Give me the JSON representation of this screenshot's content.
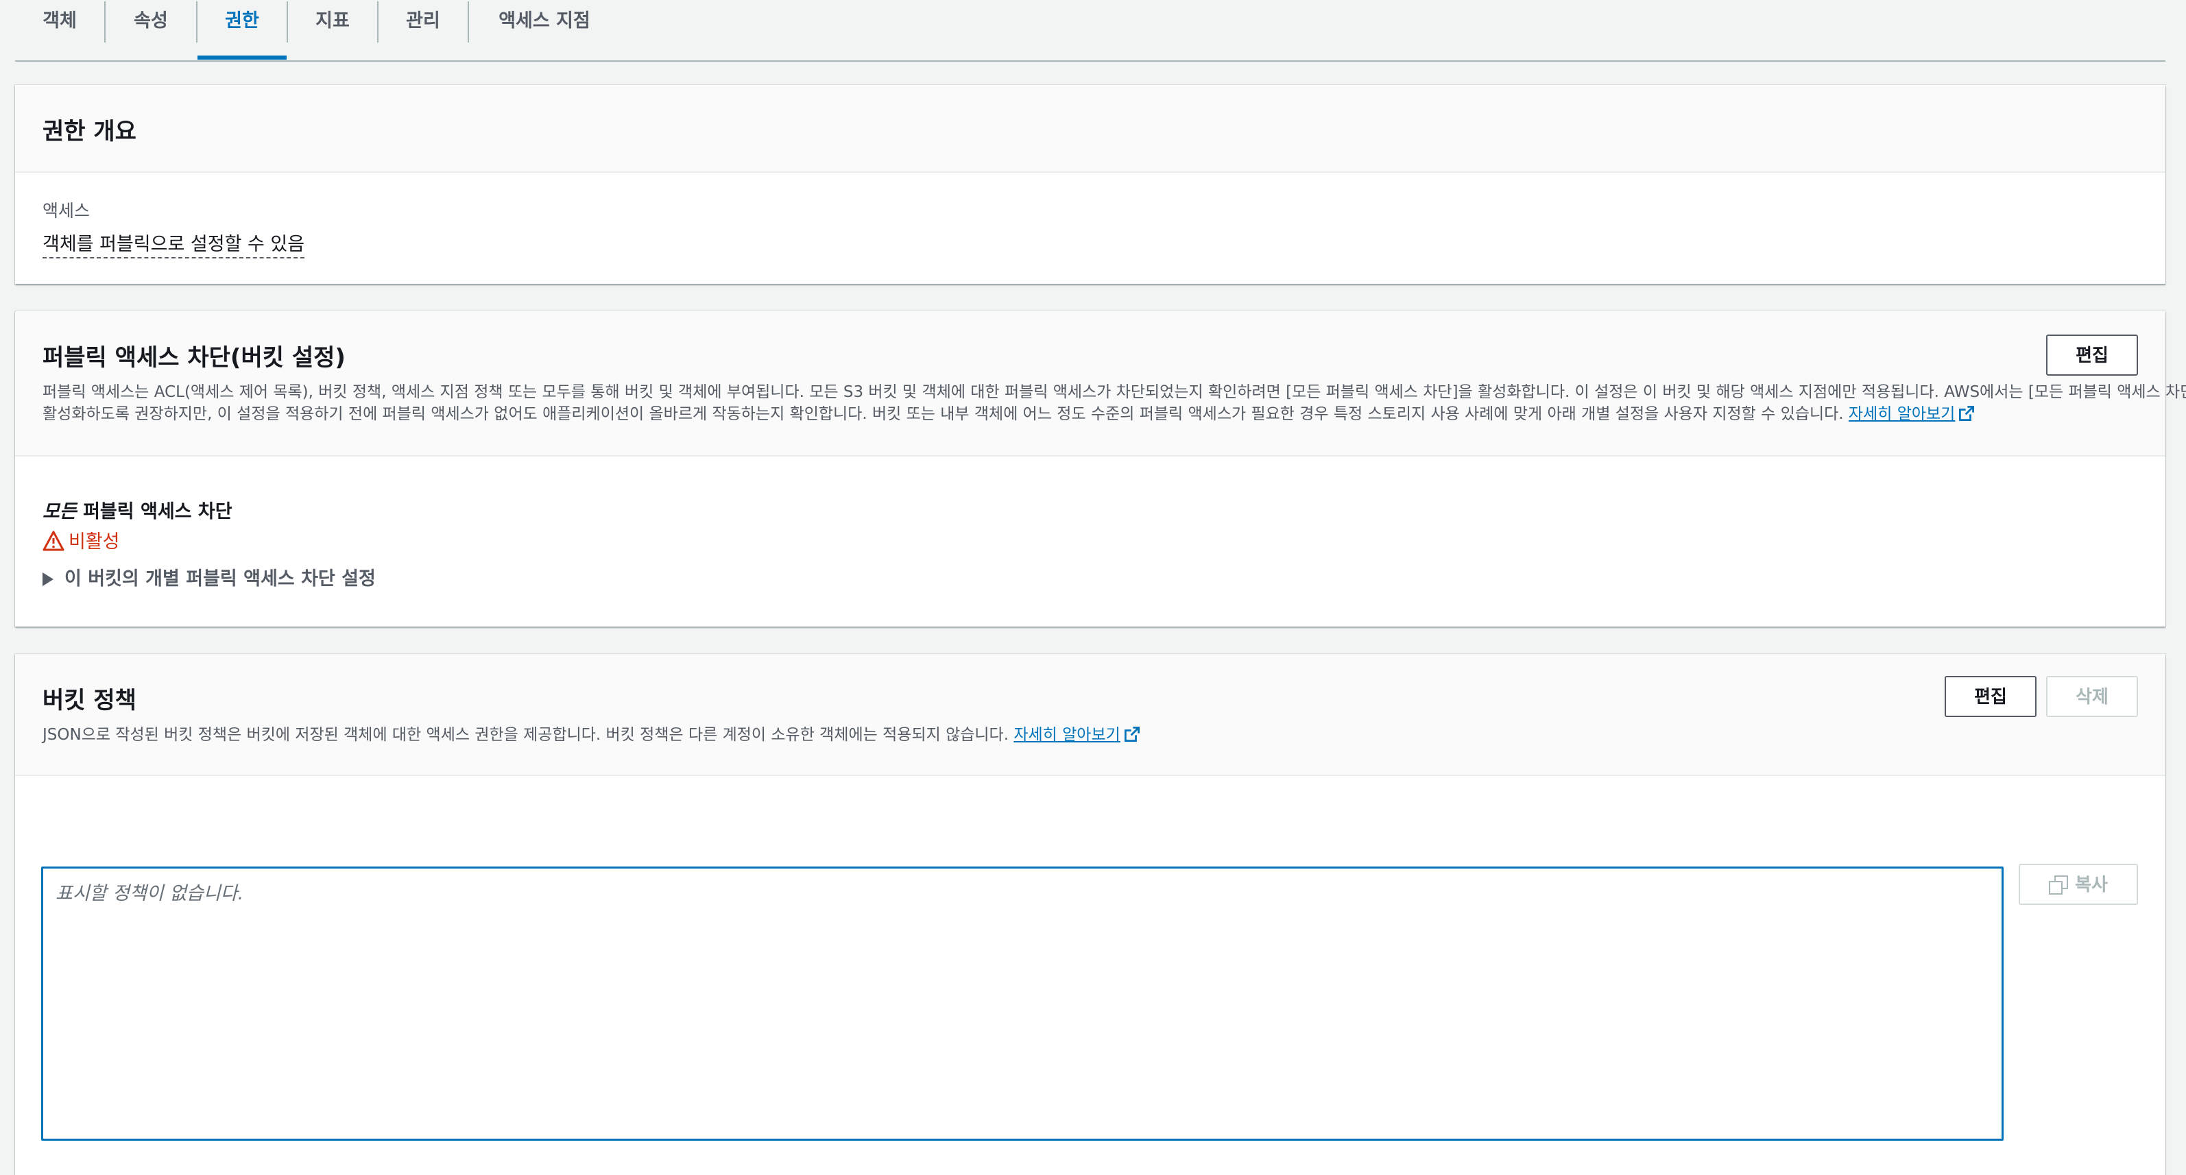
{
  "tabs": [
    {
      "label": "객체",
      "active": false
    },
    {
      "label": "속성",
      "active": false
    },
    {
      "label": "권한",
      "active": true
    },
    {
      "label": "지표",
      "active": false
    },
    {
      "label": "관리",
      "active": false
    },
    {
      "label": "액세스 지점",
      "active": false
    }
  ],
  "permissions_overview": {
    "title": "권한 개요",
    "access_label": "액세스",
    "access_value": "객체를 퍼블릭으로 설정할 수 있음"
  },
  "block_public_access": {
    "title": "퍼블릭 액세스 차단(버킷 설정)",
    "edit_label": "편집",
    "description_line1": "퍼블릭 액세스는 ACL(액세스 제어 목록), 버킷 정책, 액세스 지점 정책 또는 모두를 통해 버킷 및 객체에 부여됩니다. 모든 S3 버킷 및 객체에 대한 퍼블릭 액세스가 차단되었는지 확인하려면 [모든 퍼블릭 액세스 차단]을 활성화합니다. 이 설정은 이 버킷 및 해당 액세스 지점에만 적용됩니다. AWS에서는 [모든 퍼블릭 액세스 차단]을",
    "description_line2": "활성화하도록 권장하지만, 이 설정을 적용하기 전에 퍼블릭 액세스가 없어도 애플리케이션이 올바르게 작동하는지 확인합니다. 버킷 또는 내부 객체에 어느 정도 수준의 퍼블릭 액세스가 필요한 경우 특정 스토리지 사용 사례에 맞게 아래 개별 설정을 사용자 지정할 수 있습니다.",
    "learn_more": "자세히 알아보기",
    "block_all_em": "모든",
    "block_all_rest": " 퍼블릭 액세스 차단",
    "status": "비활성",
    "expander_label": "이 버킷의 개별 퍼블릭 액세스 차단 설정"
  },
  "bucket_policy": {
    "title": "버킷 정책",
    "description": "JSON으로 작성된 버킷 정책은 버킷에 저장된 객체에 대한 액세스 권한을 제공합니다. 버킷 정책은 다른 계정이 소유한 객체에는 적용되지 않습니다.",
    "learn_more": "자세히 알아보기",
    "edit_label": "편집",
    "delete_label": "삭제",
    "copy_label": "복사",
    "editor_placeholder": "표시할 정책이 없습니다."
  },
  "colors": {
    "accent": "#0073bb",
    "danger": "#d13212",
    "text": "#16191f",
    "muted": "#545b64",
    "background": "#f2f3f3"
  }
}
